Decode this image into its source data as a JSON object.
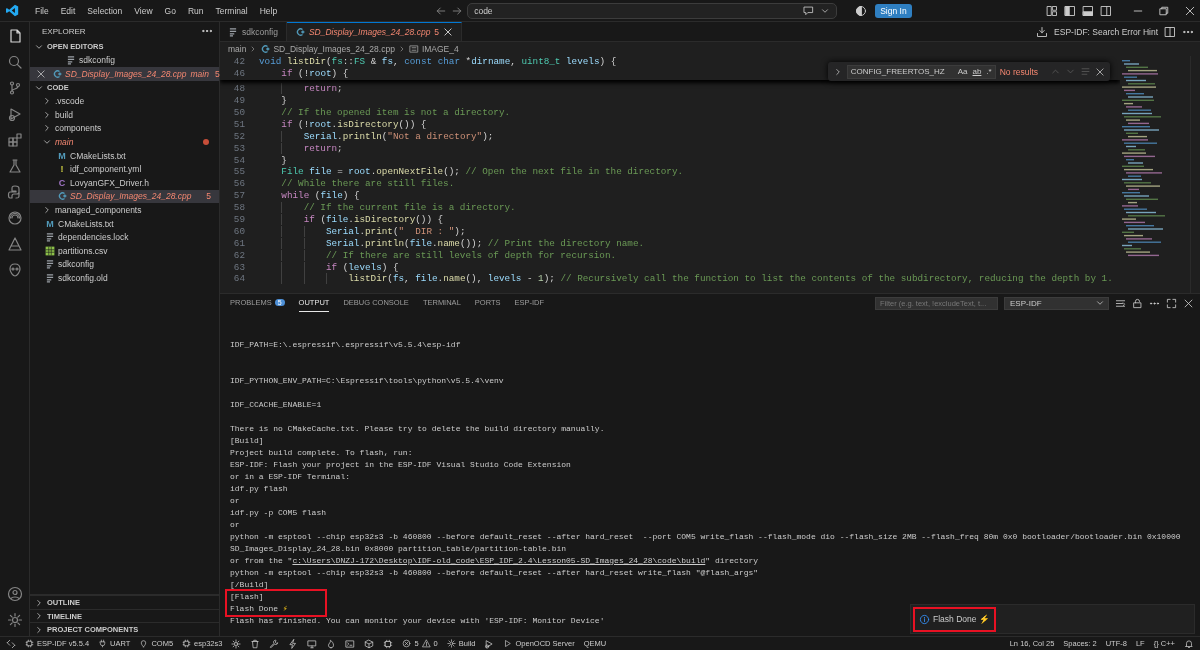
{
  "title_bar": {
    "menus": [
      "File",
      "Edit",
      "Selection",
      "View",
      "Go",
      "Run",
      "Terminal",
      "Help"
    ],
    "command_center": {
      "value": "code"
    },
    "sign_in": "Sign In"
  },
  "explorer": {
    "title": "EXPLORER",
    "open_editors": {
      "label": "OPEN EDITORS",
      "expanded": true,
      "items": [
        {
          "kind": "config",
          "name": "sdkconfig",
          "selected": false,
          "has_errors": false,
          "close_visible": false
        },
        {
          "kind": "cpp",
          "name": "SD_Display_Images_24_28.cpp",
          "description": "main",
          "badge": "5",
          "selected": true,
          "has_errors": true,
          "close_visible": true
        }
      ]
    },
    "folder": {
      "label": "CODE",
      "expanded": true,
      "children": [
        {
          "kind": "folder",
          "name": ".vscode",
          "expanded": false,
          "selected": false,
          "has_errors": false
        },
        {
          "kind": "folder",
          "name": "build",
          "expanded": false,
          "selected": false,
          "has_errors": false
        },
        {
          "kind": "folder",
          "name": "components",
          "expanded": false,
          "selected": false,
          "has_errors": false
        },
        {
          "kind": "folder",
          "name": "main",
          "expanded": true,
          "selected": false,
          "has_errors": true,
          "modified_dot": true,
          "children": [
            {
              "kind": "cmake",
              "glyph": "M",
              "name": "CMakeLists.txt",
              "selected": false,
              "has_errors": false
            },
            {
              "kind": "yaml",
              "glyph": "!",
              "name": "idf_component.yml",
              "selected": false,
              "has_errors": false
            },
            {
              "kind": "header",
              "glyph": "C",
              "name": "LovyanGFX_Driver.h",
              "selected": false,
              "has_errors": false
            },
            {
              "kind": "cpp",
              "name": "SD_Display_Images_24_28.cpp",
              "badge": "5",
              "selected": true,
              "has_errors": true
            }
          ]
        },
        {
          "kind": "folder",
          "name": "managed_components",
          "expanded": false,
          "selected": false,
          "has_errors": false
        },
        {
          "kind": "cmake",
          "glyph": "M",
          "name": "CMakeLists.txt",
          "selected": false,
          "has_errors": false
        },
        {
          "kind": "config",
          "name": "dependencies.lock",
          "selected": false,
          "has_errors": false
        },
        {
          "kind": "csv",
          "name": "partitions.csv",
          "selected": false,
          "has_errors": false
        },
        {
          "kind": "config",
          "name": "sdkconfig",
          "selected": false,
          "has_errors": false
        },
        {
          "kind": "config",
          "name": "sdkconfig.old",
          "selected": false,
          "has_errors": false
        }
      ]
    },
    "collapsed_sections": [
      {
        "label": "OUTLINE",
        "expanded": false
      },
      {
        "label": "TIMELINE",
        "expanded": false
      },
      {
        "label": "PROJECT COMPONENTS",
        "expanded": false
      }
    ]
  },
  "tabs": [
    {
      "kind": "config",
      "label": "sdkconfig",
      "selected": false,
      "has_errors": false
    },
    {
      "kind": "cpp",
      "label": "SD_Display_Images_24_28.cpp",
      "badge": "5",
      "selected": true,
      "has_errors": true
    }
  ],
  "editor_actions": {
    "hint": "ESP-IDF: Search Error Hint"
  },
  "breadcrumb": [
    {
      "kind": "folder",
      "label": "main"
    },
    {
      "kind": "cpp",
      "label": "SD_Display_Images_24_28.cpp"
    },
    {
      "kind": "symbol",
      "label": "IMAGE_4"
    }
  ],
  "find_widget": {
    "query": "CONFIG_FREERTOS_HZ",
    "options": [
      {
        "kind": "match_case",
        "label": "Aa"
      },
      {
        "kind": "whole_word",
        "label": "ab"
      },
      {
        "kind": "regex",
        "label": ".*"
      }
    ],
    "status": "No results"
  },
  "code": {
    "sticky": [
      {
        "number": "42",
        "tokens": [
          {
            "kind": "kw",
            "text": "void"
          },
          {
            "kind": "fn",
            "text": " listDir"
          },
          {
            "kind": "p",
            "text": "("
          },
          {
            "kind": "ty",
            "text": "fs"
          },
          {
            "kind": "p",
            "text": "::"
          },
          {
            "kind": "ty",
            "text": "FS"
          },
          {
            "kind": "p",
            "text": " & "
          },
          {
            "kind": "var",
            "text": "fs"
          },
          {
            "kind": "p",
            "text": ", "
          },
          {
            "kind": "kw",
            "text": "const"
          },
          {
            "kind": "kw",
            "text": " char"
          },
          {
            "kind": "p",
            "text": " *"
          },
          {
            "kind": "var",
            "text": "dirname"
          },
          {
            "kind": "p",
            "text": ", "
          },
          {
            "kind": "ty",
            "text": "uint8_t"
          },
          {
            "kind": "var",
            "text": " levels"
          },
          {
            "kind": "p",
            "text": ") {"
          }
        ]
      },
      {
        "number": "46",
        "tokens": [
          {
            "kind": "ctl",
            "text": "    if"
          },
          {
            "kind": "p",
            "text": " (!"
          },
          {
            "kind": "var",
            "text": "root"
          },
          {
            "kind": "p",
            "text": ") {"
          }
        ]
      }
    ],
    "lines": [
      {
        "number": "48",
        "tokens": [
          {
            "kind": "ctl",
            "text": "        return"
          },
          {
            "kind": "p",
            "text": ";"
          }
        ]
      },
      {
        "number": "49",
        "tokens": [
          {
            "kind": "p",
            "text": "    }"
          }
        ]
      },
      {
        "number": "50",
        "tokens": [
          {
            "kind": "cm",
            "text": "    // If the opened item is not a directory."
          }
        ]
      },
      {
        "number": "51",
        "tokens": [
          {
            "kind": "ctl",
            "text": "    if"
          },
          {
            "kind": "p",
            "text": " (!"
          },
          {
            "kind": "var",
            "text": "root"
          },
          {
            "kind": "p",
            "text": "."
          },
          {
            "kind": "fn",
            "text": "isDirectory"
          },
          {
            "kind": "p",
            "text": "()) {"
          }
        ]
      },
      {
        "number": "52",
        "tokens": [
          {
            "kind": "var",
            "text": "        Serial"
          },
          {
            "kind": "p",
            "text": "."
          },
          {
            "kind": "fn",
            "text": "println"
          },
          {
            "kind": "p",
            "text": "("
          },
          {
            "kind": "str",
            "text": "\"Not a directory\""
          },
          {
            "kind": "p",
            "text": ");"
          }
        ]
      },
      {
        "number": "53",
        "tokens": [
          {
            "kind": "ctl",
            "text": "        return"
          },
          {
            "kind": "p",
            "text": ";"
          }
        ]
      },
      {
        "number": "54",
        "tokens": [
          {
            "kind": "p",
            "text": "    }"
          }
        ]
      },
      {
        "number": "55",
        "tokens": [
          {
            "kind": "ty",
            "text": "    File"
          },
          {
            "kind": "var",
            "text": " file"
          },
          {
            "kind": "p",
            "text": " = "
          },
          {
            "kind": "var",
            "text": "root"
          },
          {
            "kind": "p",
            "text": "."
          },
          {
            "kind": "fn",
            "text": "openNextFile"
          },
          {
            "kind": "p",
            "text": "(); "
          },
          {
            "kind": "cm",
            "text": "// Open the next file in the directory."
          }
        ]
      },
      {
        "number": "56",
        "tokens": [
          {
            "kind": "cm",
            "text": "    // While there are still files."
          }
        ]
      },
      {
        "number": "57",
        "tokens": [
          {
            "kind": "ctl",
            "text": "    while"
          },
          {
            "kind": "p",
            "text": " ("
          },
          {
            "kind": "var",
            "text": "file"
          },
          {
            "kind": "p",
            "text": ") {"
          }
        ]
      },
      {
        "number": "58",
        "tokens": [
          {
            "kind": "cm",
            "text": "        // If the current file is a directory."
          }
        ]
      },
      {
        "number": "59",
        "tokens": [
          {
            "kind": "ctl",
            "text": "        if"
          },
          {
            "kind": "p",
            "text": " ("
          },
          {
            "kind": "var",
            "text": "file"
          },
          {
            "kind": "p",
            "text": "."
          },
          {
            "kind": "fn",
            "text": "isDirectory"
          },
          {
            "kind": "p",
            "text": "()) {"
          }
        ]
      },
      {
        "number": "60",
        "tokens": [
          {
            "kind": "var",
            "text": "            Serial"
          },
          {
            "kind": "p",
            "text": "."
          },
          {
            "kind": "fn",
            "text": "print"
          },
          {
            "kind": "p",
            "text": "("
          },
          {
            "kind": "str",
            "text": "\"  DIR : \""
          },
          {
            "kind": "p",
            "text": ");"
          }
        ]
      },
      {
        "number": "61",
        "tokens": [
          {
            "kind": "var",
            "text": "            Serial"
          },
          {
            "kind": "p",
            "text": "."
          },
          {
            "kind": "fn",
            "text": "println"
          },
          {
            "kind": "p",
            "text": "("
          },
          {
            "kind": "var",
            "text": "file"
          },
          {
            "kind": "p",
            "text": "."
          },
          {
            "kind": "fn",
            "text": "name"
          },
          {
            "kind": "p",
            "text": "()); "
          },
          {
            "kind": "cm",
            "text": "// Print the directory name."
          }
        ]
      },
      {
        "number": "62",
        "tokens": [
          {
            "kind": "cm",
            "text": "            // If there are still levels of depth for recursion."
          }
        ]
      },
      {
        "number": "63",
        "tokens": [
          {
            "kind": "ctl",
            "text": "            if"
          },
          {
            "kind": "p",
            "text": " ("
          },
          {
            "kind": "var",
            "text": "levels"
          },
          {
            "kind": "p",
            "text": ") {"
          }
        ]
      },
      {
        "number": "64",
        "tokens": [
          {
            "kind": "fn",
            "text": "                listDir"
          },
          {
            "kind": "p",
            "text": "("
          },
          {
            "kind": "var",
            "text": "fs"
          },
          {
            "kind": "p",
            "text": ", "
          },
          {
            "kind": "var",
            "text": "file"
          },
          {
            "kind": "p",
            "text": "."
          },
          {
            "kind": "fn",
            "text": "name"
          },
          {
            "kind": "p",
            "text": "(), "
          },
          {
            "kind": "var",
            "text": "levels"
          },
          {
            "kind": "p",
            "text": " - "
          },
          {
            "kind": "num",
            "text": "1"
          },
          {
            "kind": "p",
            "text": "); "
          },
          {
            "kind": "cm",
            "text": "// Recursively call the function to list the contents of the subdirectory, reducing the depth by 1."
          }
        ]
      }
    ]
  },
  "panel": {
    "tabs": [
      {
        "label": "PROBLEMS",
        "badge": "5",
        "selected": false
      },
      {
        "label": "OUTPUT",
        "selected": true
      },
      {
        "label": "DEBUG CONSOLE",
        "selected": false
      },
      {
        "label": "TERMINAL",
        "selected": false
      },
      {
        "label": "PORTS",
        "selected": false
      },
      {
        "label": "ESP-IDF",
        "selected": false
      }
    ],
    "filter": {
      "placeholder": "Filter (e.g. text, !excludeText, t..."
    },
    "channel": "ESP-IDF",
    "output": [
      {
        "kind": "blank"
      },
      {
        "kind": "text",
        "text": "IDF_PATH=E:\\.espressif\\.espressif\\v5.5.4\\esp-idf"
      },
      {
        "kind": "blank"
      },
      {
        "kind": "blank"
      },
      {
        "kind": "text",
        "text": "IDF_PYTHON_ENV_PATH=C:\\Espressif\\tools\\python\\v5.5.4\\venv"
      },
      {
        "kind": "blank"
      },
      {
        "kind": "text",
        "text": "IDF_CCACHE_ENABLE=1"
      },
      {
        "kind": "blank"
      },
      {
        "kind": "text",
        "text": "There is no CMakeCache.txt. Please try to delete the build directory manually."
      },
      {
        "kind": "text",
        "text": "[Build]"
      },
      {
        "kind": "text",
        "text": "Project build complete. To flash, run:"
      },
      {
        "kind": "text",
        "text": "ESP-IDF: Flash your project in the ESP-IDF Visual Studio Code Extension"
      },
      {
        "kind": "text",
        "text": "or in a ESP-IDF Terminal:"
      },
      {
        "kind": "text",
        "text": "idf.py flash"
      },
      {
        "kind": "text",
        "text": "or"
      },
      {
        "kind": "text",
        "text": "idf.py -p COM5 flash"
      },
      {
        "kind": "text",
        "text": "or"
      },
      {
        "kind": "text",
        "text": "python -m esptool --chip esp32s3 -b 460800 --before default_reset --after hard_reset  --port COM5 write_flash --flash_mode dio --flash_size 2MB --flash_freq 80m 0x0 bootloader/bootloader.bin 0x10000"
      },
      {
        "kind": "text",
        "text": "SD_Images_Display_24_28.bin 0x8000 partition_table/partition-table.bin"
      },
      {
        "kind": "link",
        "prefix": "or from the \"",
        "link": "c:\\Users\\DNZJ-172\\Desktop\\IDF-old_code\\ESP_IDF_2.4\\Lesson05-SD_Images_24_28\\code\\build",
        "suffix": "\" directory"
      },
      {
        "kind": "text",
        "text": "python -m esptool --chip esp32s3 -b 460800 --before default_reset --after hard_reset write_flash \"@flash_args\""
      },
      {
        "kind": "text",
        "text": "[/Build]"
      },
      {
        "kind": "text",
        "text": "[Flash]",
        "highlighted": true
      },
      {
        "kind": "text",
        "text": "Flash Done",
        "emoji": "⚡",
        "highlighted": true
      },
      {
        "kind": "text",
        "text": "Flash has finished. You can monitor your device with 'ESP-IDF: Monitor Device'"
      }
    ],
    "toast": {
      "text": "Flash Done",
      "emoji": "⚡",
      "highlighted": true
    }
  },
  "status_bar": {
    "left": [
      "ESP-IDF v5.5.4",
      "UART",
      "COM5",
      "esp32s3"
    ],
    "problems": {
      "errors": "5",
      "warnings": "0"
    },
    "build": "Build",
    "tail": [
      "OpenOCD Server",
      "QEMU"
    ],
    "right": [
      "Ln 16, Col 25",
      "Spaces: 2",
      "UTF-8",
      "LF"
    ],
    "language": {
      "glyph": "{}",
      "text": "C++"
    }
  }
}
